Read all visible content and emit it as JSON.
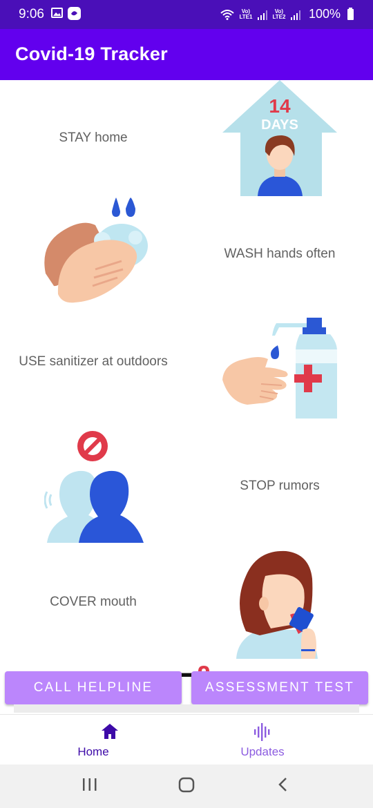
{
  "status_bar": {
    "time": "9:06",
    "sim1": "Vo) LTE1",
    "sim2": "Vo) LTE2",
    "battery": "100%"
  },
  "app_bar": {
    "title": "Covid-19 Tracker"
  },
  "tips": [
    {
      "text": "STAY home",
      "badge_number": "14",
      "badge_unit": "DAYS"
    },
    {
      "text": "WASH hands often"
    },
    {
      "text": "USE sanitizer at outdoors"
    },
    {
      "text": "STOP rumors"
    },
    {
      "text": "COVER mouth"
    }
  ],
  "buttons": {
    "call_helpline": "CALL HELPLINE",
    "assessment_test": "ASSESSMENT TEST"
  },
  "bottom_nav": [
    {
      "label": "Home",
      "icon": "home-icon",
      "selected": true
    },
    {
      "label": "Updates",
      "icon": "audio-wave-icon",
      "selected": false
    }
  ],
  "colors": {
    "status_bar": "#4a0fb8",
    "app_bar": "#6200ee",
    "button": "#bb86fc",
    "nav_selected": "#3d0aa8"
  }
}
